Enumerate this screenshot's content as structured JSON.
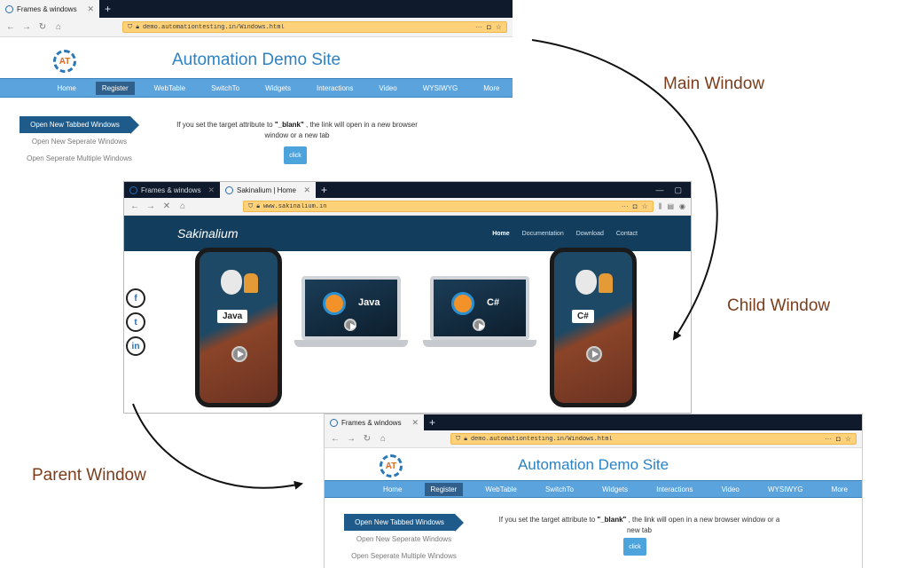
{
  "annotations": {
    "main_window": "Main Window",
    "child_window": "Child Window",
    "parent_window": "Parent Window"
  },
  "main_window": {
    "tab_title": "Frames & windows",
    "url": "demo.automationtesting.in/Windows.html",
    "site_title": "Automation Demo Site",
    "logo_letters": "AT",
    "menu": [
      "Home",
      "Register",
      "WebTable",
      "SwitchTo",
      "Widgets",
      "Interactions",
      "Video",
      "WYSIWYG",
      "More"
    ],
    "menu_active_index": 1,
    "side_menu": [
      "Open New Tabbed Windows",
      "Open New Seperate Windows",
      "Open Seperate Multiple Windows"
    ],
    "info_prefix": "If you set the target attribute to ",
    "info_bold": "\"_blank\"",
    "info_suffix": " , the link will open in a new browser window or a new tab",
    "click_label": "click"
  },
  "child_window": {
    "tab1_title": "Frames & windows",
    "tab2_title": "Sakinalium | Home",
    "url": "www.sakinalium.in",
    "logo": "Sakinalium",
    "nav": [
      "Home",
      "Documentation",
      "Download",
      "Contact"
    ],
    "phone_left_label": "Java",
    "phone_right_label": "C#",
    "laptop_left_label": "Java",
    "laptop_right_label": "C#",
    "social": [
      "f",
      "t",
      "in"
    ]
  },
  "parent_window": {
    "tab_title": "Frames & windows",
    "url": "demo.automationtesting.in/Windows.html",
    "site_title": "Automation Demo Site",
    "logo_letters": "AT",
    "menu": [
      "Home",
      "Register",
      "WebTable",
      "SwitchTo",
      "Widgets",
      "Interactions",
      "Video",
      "WYSIWYG",
      "More"
    ],
    "menu_active_index": 1,
    "side_menu": [
      "Open New Tabbed Windows",
      "Open New Seperate Windows",
      "Open Seperate Multiple Windows"
    ],
    "info_prefix": "If you set the target attribute to ",
    "info_bold": "\"_blank\"",
    "info_suffix": " , the link will open in a new browser window or a new tab",
    "click_label": "click"
  },
  "colors": {
    "annotation_text": "#7a3e1d",
    "site_title": "#2d82c4",
    "menu_bar": "#5aa3dd",
    "url_bar": "#ffd27a",
    "tab_strip": "#0f1b2c",
    "sakinalium_header": "#123d5c"
  },
  "icons": [
    "back-icon",
    "forward-icon",
    "reload-icon",
    "close-load-icon",
    "home-icon",
    "shield-icon",
    "lock-icon",
    "star-icon",
    "pocket-icon",
    "library-icon",
    "facebook-icon",
    "twitter-icon",
    "linkedin-icon",
    "apple-icon",
    "android-icon",
    "play-icon",
    "selenium-icon"
  ]
}
